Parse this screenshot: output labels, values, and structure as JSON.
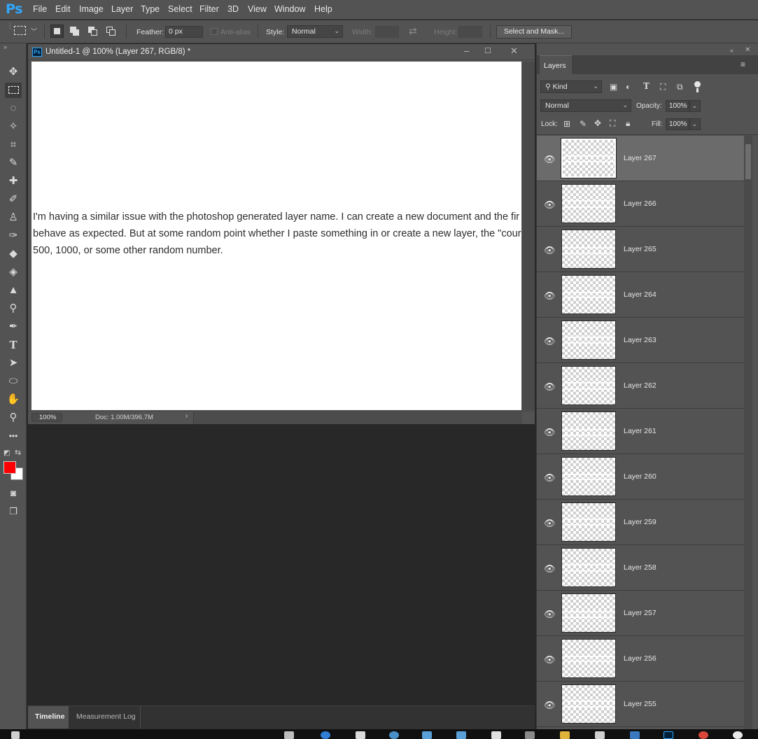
{
  "app": {
    "logo": "Ps",
    "accent": "#31a8ff"
  },
  "menu": [
    "File",
    "Edit",
    "Image",
    "Layer",
    "Type",
    "Select",
    "Filter",
    "3D",
    "View",
    "Window",
    "Help"
  ],
  "options": {
    "feather_label": "Feather:",
    "feather_value": "0 px",
    "antialias_label": "Anti-alias",
    "style_label": "Style:",
    "style_value": "Normal",
    "width_label": "Width:",
    "height_label": "Height:",
    "select_mask_label": "Select and Mask..."
  },
  "document": {
    "title": "Untitled-1 @ 100% (Layer 267, RGB/8) *",
    "text_lines": [
      "I'm having a similar issue with the photoshop generated layer name. I can create a new document and the fir",
      "behave as expected. But at some random point whether I paste something in or create a new layer, the \"cour",
      "500, 1000, or some other random number."
    ],
    "zoom": "100%",
    "doc_size": "Doc: 1.00M/396.7M"
  },
  "colors": {
    "foreground": "#ff0000",
    "background": "#ffffff"
  },
  "layers_panel": {
    "tab_label": "Layers",
    "filter_label": "Kind",
    "blend_mode": "Normal",
    "opacity_label": "Opacity:",
    "opacity_value": "100%",
    "lock_label": "Lock:",
    "fill_label": "Fill:",
    "fill_value": "100%",
    "layers": [
      {
        "name": "Layer 267",
        "selected": true
      },
      {
        "name": "Layer 266",
        "selected": false
      },
      {
        "name": "Layer 265",
        "selected": false
      },
      {
        "name": "Layer 264",
        "selected": false
      },
      {
        "name": "Layer 263",
        "selected": false
      },
      {
        "name": "Layer 262",
        "selected": false
      },
      {
        "name": "Layer 261",
        "selected": false
      },
      {
        "name": "Layer 260",
        "selected": false
      },
      {
        "name": "Layer 259",
        "selected": false
      },
      {
        "name": "Layer 258",
        "selected": false
      },
      {
        "name": "Layer 257",
        "selected": false
      },
      {
        "name": "Layer 256",
        "selected": false
      },
      {
        "name": "Layer 255",
        "selected": false
      }
    ]
  },
  "bottom_tabs": [
    "Timeline",
    "Measurement Log"
  ]
}
